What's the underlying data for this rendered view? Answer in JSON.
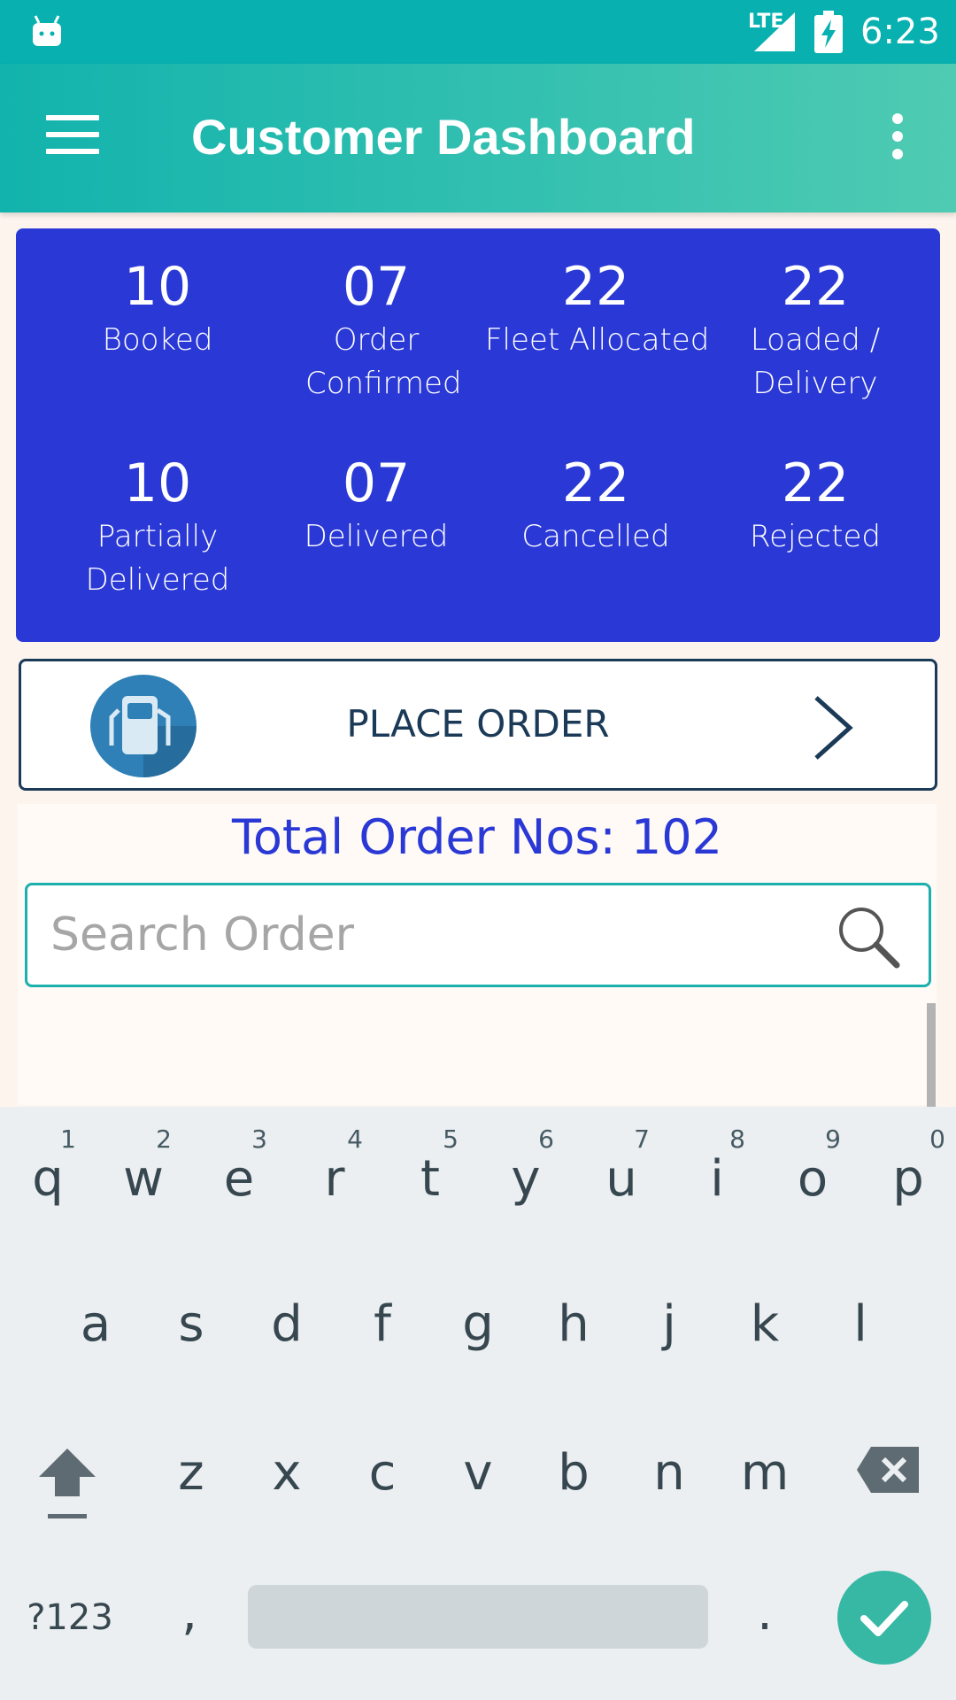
{
  "status_bar": {
    "network": "LTE",
    "time": "6:23"
  },
  "app_bar": {
    "title": "Customer Dashboard"
  },
  "stats": [
    {
      "value": "10",
      "label": "Booked"
    },
    {
      "value": "07",
      "label": "Order Confirmed"
    },
    {
      "value": "22",
      "label": "Fleet Allocated"
    },
    {
      "value": "22",
      "label": "Loaded / Delivery"
    },
    {
      "value": "10",
      "label": "Partially Delivered"
    },
    {
      "value": "07",
      "label": "Delivered"
    },
    {
      "value": "22",
      "label": "Cancelled"
    },
    {
      "value": "22",
      "label": "Rejected"
    }
  ],
  "place_order": {
    "label": "PLACE ORDER"
  },
  "orders": {
    "total_label": "Total Order Nos: 102",
    "search_placeholder": "Search Order"
  },
  "keyboard": {
    "row1": [
      "q",
      "w",
      "e",
      "r",
      "t",
      "y",
      "u",
      "i",
      "o",
      "p"
    ],
    "row1_hints": [
      "1",
      "2",
      "3",
      "4",
      "5",
      "6",
      "7",
      "8",
      "9",
      "0"
    ],
    "row2": [
      "a",
      "s",
      "d",
      "f",
      "g",
      "h",
      "j",
      "k",
      "l"
    ],
    "row3": [
      "z",
      "x",
      "c",
      "v",
      "b",
      "n",
      "m"
    ],
    "symbols_label": "?123",
    "comma": ",",
    "period": "."
  },
  "colors": {
    "status_bar": "#08b0b0",
    "stats_panel": "#2a38d6",
    "accent_teal": "#1ab0ad",
    "dark_navy": "#1b3a57"
  }
}
